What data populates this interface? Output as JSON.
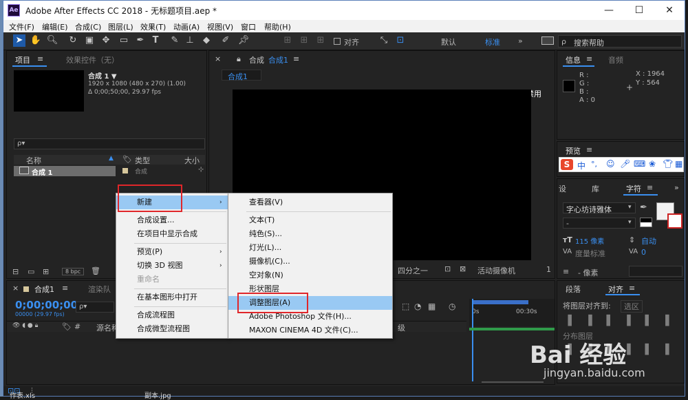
{
  "window": {
    "title": "Adobe After Effects CC 2018 - 无标题项目.aep *",
    "logo": "Ae"
  },
  "menu": [
    "文件(F)",
    "编辑(E)",
    "合成(C)",
    "图层(L)",
    "效果(T)",
    "动画(A)",
    "视图(V)",
    "窗口",
    "帮助(H)"
  ],
  "toolbar": {
    "align_label": "对齐",
    "workspaces": [
      "默认",
      "标准"
    ],
    "search_placeholder": "搜索帮助"
  },
  "project": {
    "tab_project": "项目",
    "tab_effects": "效果控件（无）",
    "comp_name": "合成 1 ▼",
    "comp_info1": "1920 x 1080 (480 x 270) (1.00)",
    "comp_info2": "Δ 0;00;50;00, 29.97 fps",
    "search_placeholder": "ρ▾",
    "col_name": "名称",
    "col_type": "类型",
    "col_size": "大小",
    "row_name": "合成 1",
    "row_type": "合成",
    "bpc": "8 bpc"
  },
  "composition": {
    "tab": "合成",
    "tab_name": "合成1",
    "subtab": "合成1",
    "gpu_note": "显示加速已禁用",
    "quality": "四分之一",
    "camera": "活动摄像机",
    "extra": "1"
  },
  "info": {
    "tab_info": "信息",
    "tab_audio": "音频",
    "r": "R :",
    "g": "G :",
    "b": "B :",
    "a": "A : 0",
    "x": "X : 1964",
    "y": "Y : 564"
  },
  "preview": {
    "tab": "预览",
    "ime": [
      "中",
      "°,"
    ]
  },
  "character": {
    "tab_set": "设",
    "tab_lib": "库",
    "tab_char": "字符",
    "font": "字心坊诗雅体",
    "style": "-",
    "size": "115 像素",
    "leading": "自动",
    "kerning": "度量标准",
    "tracking": "0",
    "stroke": "- 像素"
  },
  "paragraph": {
    "tab_para": "段落",
    "tab_align": "对齐",
    "align_to": "将图层对齐到:",
    "align_to_value": "选区",
    "distribute": "分布图层"
  },
  "timeline": {
    "tab": "合成1",
    "tab_render": "渲染队",
    "timecode": "0;00;00;00",
    "frames": "00000 (29.97 fps)",
    "col_source": "源名称",
    "col_parent": "级",
    "hash": "#",
    "ruler_0": "0s",
    "ruler_30": "00:30s"
  },
  "context_menu": {
    "items": [
      "新建",
      "合成设置...",
      "在项目中显示合成",
      "预览(P)",
      "切换 3D 视图",
      "重命名",
      "在基本图形中打开",
      "合成流程图",
      "合成微型流程图"
    ]
  },
  "submenu": {
    "items": [
      "查看器(V)",
      "文本(T)",
      "纯色(S)...",
      "灯光(L)...",
      "摄像机(C)...",
      "空对象(N)",
      "形状图层",
      "调整图层(A)",
      "Adobe Photoshop 文件(H)...",
      "MAXON CINEMA 4D 文件(C)..."
    ]
  },
  "desktop": {
    "file1": "作表.xls",
    "file2": "副本.jpg"
  },
  "watermark": {
    "text": "Bai 经验",
    "sub": "jingyan.baidu.com"
  },
  "colors": {
    "accent": "#3a8ff0",
    "highlight": "#99c9f3",
    "red_box": "#e0262a"
  }
}
